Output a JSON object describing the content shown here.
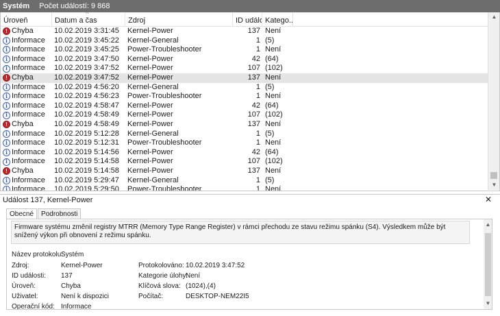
{
  "topbar": {
    "title": "Systém",
    "count_label": "Počet událostí: 9 868"
  },
  "columns": {
    "level": "Úroveň",
    "date": "Datum a čas",
    "source": "Zdroj",
    "id": "ID událost...",
    "category": "Katego..."
  },
  "rows": [
    {
      "level": "Chyba",
      "type": "error",
      "date": "10.02.2019 3:31:45",
      "source": "Kernel-Power",
      "id": "137",
      "category": "Není"
    },
    {
      "level": "Informace",
      "type": "info",
      "date": "10.02.2019 3:45:22",
      "source": "Kernel-General",
      "id": "1",
      "category": "(5)"
    },
    {
      "level": "Informace",
      "type": "info",
      "date": "10.02.2019 3:45:25",
      "source": "Power-Troubleshooter",
      "id": "1",
      "category": "Není"
    },
    {
      "level": "Informace",
      "type": "info",
      "date": "10.02.2019 3:47:50",
      "source": "Kernel-Power",
      "id": "42",
      "category": "(64)"
    },
    {
      "level": "Informace",
      "type": "info",
      "date": "10.02.2019 3:47:52",
      "source": "Kernel-Power",
      "id": "107",
      "category": "(102)"
    },
    {
      "level": "Chyba",
      "type": "error",
      "date": "10.02.2019 3:47:52",
      "source": "Kernel-Power",
      "id": "137",
      "category": "Není",
      "selected": true
    },
    {
      "level": "Informace",
      "type": "info",
      "date": "10.02.2019 4:56:20",
      "source": "Kernel-General",
      "id": "1",
      "category": "(5)"
    },
    {
      "level": "Informace",
      "type": "info",
      "date": "10.02.2019 4:56:23",
      "source": "Power-Troubleshooter",
      "id": "1",
      "category": "Není"
    },
    {
      "level": "Informace",
      "type": "info",
      "date": "10.02.2019 4:58:47",
      "source": "Kernel-Power",
      "id": "42",
      "category": "(64)"
    },
    {
      "level": "Informace",
      "type": "info",
      "date": "10.02.2019 4:58:49",
      "source": "Kernel-Power",
      "id": "107",
      "category": "(102)"
    },
    {
      "level": "Chyba",
      "type": "error",
      "date": "10.02.2019 4:58:49",
      "source": "Kernel-Power",
      "id": "137",
      "category": "Není"
    },
    {
      "level": "Informace",
      "type": "info",
      "date": "10.02.2019 5:12:28",
      "source": "Kernel-General",
      "id": "1",
      "category": "(5)"
    },
    {
      "level": "Informace",
      "type": "info",
      "date": "10.02.2019 5:12:31",
      "source": "Power-Troubleshooter",
      "id": "1",
      "category": "Není"
    },
    {
      "level": "Informace",
      "type": "info",
      "date": "10.02.2019 5:14:56",
      "source": "Kernel-Power",
      "id": "42",
      "category": "(64)"
    },
    {
      "level": "Informace",
      "type": "info",
      "date": "10.02.2019 5:14:58",
      "source": "Kernel-Power",
      "id": "107",
      "category": "(102)"
    },
    {
      "level": "Chyba",
      "type": "error",
      "date": "10.02.2019 5:14:58",
      "source": "Kernel-Power",
      "id": "137",
      "category": "Není"
    },
    {
      "level": "Informace",
      "type": "info",
      "date": "10.02.2019 5:29:47",
      "source": "Kernel-General",
      "id": "1",
      "category": "(5)"
    },
    {
      "level": "Informace",
      "type": "info",
      "date": "10.02.2019 5:29:50",
      "source": "Power-Troubleshooter",
      "id": "1",
      "category": "Není"
    }
  ],
  "detail": {
    "title": "Událost 137, Kernel-Power",
    "tabs": [
      "Obecné",
      "Podrobnosti"
    ],
    "description": "Firmware systému změnil registry MTRR (Memory Type Range Register) v rámci přechodu ze stavu režimu spánku (S4). Výsledkem může být snížený výkon při obnovení z režimu spánku.",
    "labels": {
      "log_name": "Název protokolu:",
      "source": "Zdroj:",
      "event_id": "ID události:",
      "level": "Úroveň:",
      "user": "Uživatel:",
      "opcode": "Operační kód:",
      "logged": "Protokolováno:",
      "task_category": "Kategorie úlohy:",
      "keywords": "Klíčová slova:",
      "computer": "Počítač:"
    },
    "values": {
      "log_name": "Systém",
      "source": "Kernel-Power",
      "event_id": "137",
      "level": "Chyba",
      "user": "Není k dispozici",
      "opcode": "Informace",
      "logged": "10.02.2019 3:47:52",
      "task_category": "Není",
      "keywords": "(1024),(4)",
      "computer": "DESKTOP-NEM22I5"
    }
  },
  "colors": {
    "error": "#c0282d",
    "info": "#3a5fa8",
    "topbar": "#6d6d6d",
    "selected_row": "#e5e5e5"
  },
  "icons": {
    "error": "error-circle-icon",
    "info": "info-circle-icon",
    "close": "close-icon"
  }
}
